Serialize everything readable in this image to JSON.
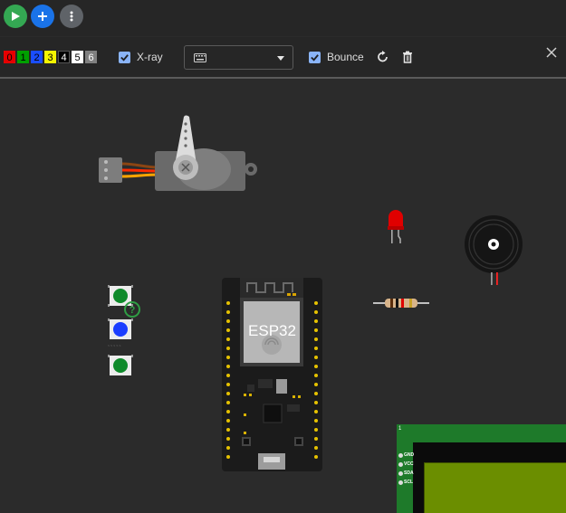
{
  "top_actions": [
    {
      "name": "run",
      "color": "#34a853"
    },
    {
      "name": "add-part",
      "color": "#1a73e8"
    },
    {
      "name": "more-options",
      "color": "#5f6368"
    }
  ],
  "toolbar": {
    "color_keys": [
      {
        "key": "0",
        "bg": "#e60000",
        "fg": "#000000"
      },
      {
        "key": "1",
        "bg": "#00a000",
        "fg": "#000000"
      },
      {
        "key": "2",
        "bg": "#1a4dff",
        "fg": "#000000"
      },
      {
        "key": "3",
        "bg": "#f5f500",
        "fg": "#000000"
      },
      {
        "key": "4",
        "bg": "#000000",
        "fg": "#ffffff"
      },
      {
        "key": "5",
        "bg": "#ffffff",
        "fg": "#000000"
      },
      {
        "key": "6",
        "bg": "#808080",
        "fg": "#ffffff"
      }
    ],
    "xray_label": "X-ray",
    "xray_checked": true,
    "bounce_label": "Bounce",
    "bounce_checked": true,
    "accent": "#8ab4f8"
  },
  "canvas": {
    "esp32_label": "ESP32",
    "lcd_pins": [
      "GND",
      "VCC",
      "SDA",
      "SCL"
    ],
    "pin_one_label": "1",
    "pushbutton_colors": [
      "green",
      "blue",
      "green"
    ]
  }
}
